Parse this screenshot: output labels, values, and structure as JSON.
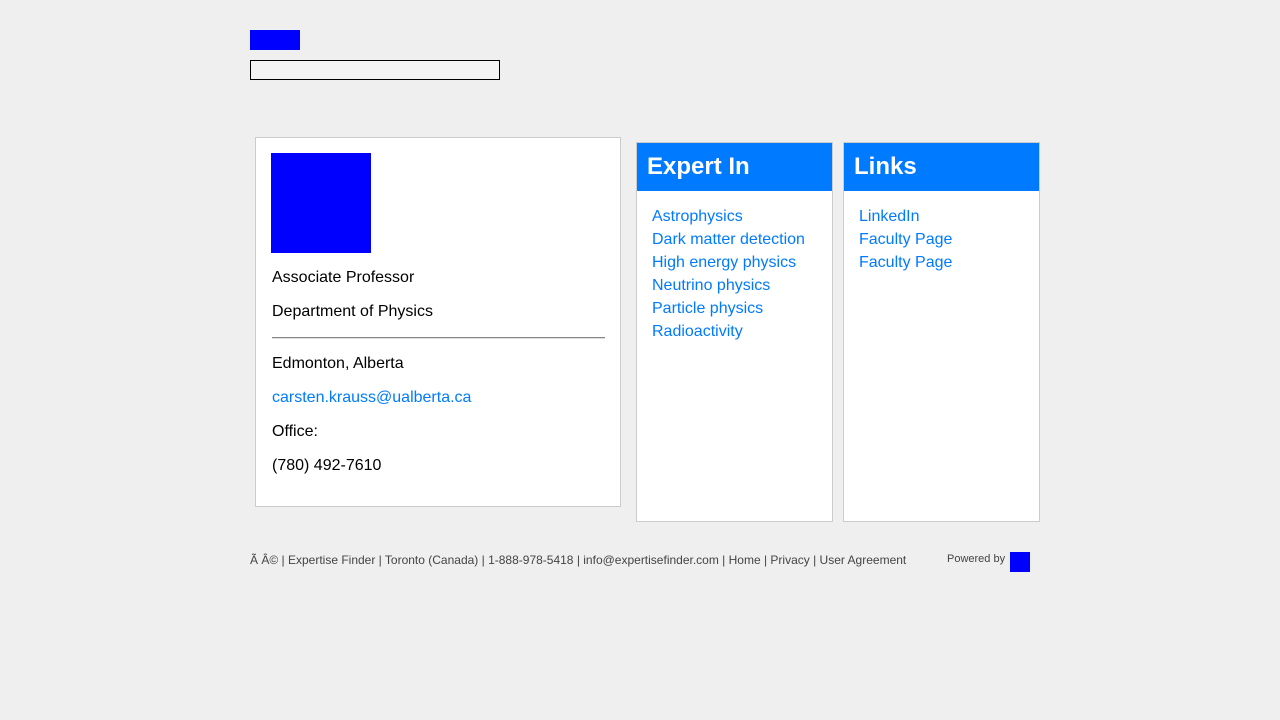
{
  "search": {
    "value": ""
  },
  "profile": {
    "title": "Associate Professor",
    "department": "Department of Physics",
    "location": "Edmonton, Alberta",
    "email": "carsten.krauss@ualberta.ca",
    "office_label": "Office:",
    "phone": "(780) 492-7610"
  },
  "expert": {
    "heading": "Expert In",
    "items": [
      "Astrophysics",
      "Dark matter detection",
      "High energy physics",
      "Neutrino physics",
      "Particle physics",
      "Radioactivity"
    ]
  },
  "links": {
    "heading": "Links",
    "items": [
      "LinkedIn",
      "Faculty Page",
      "Faculty Page"
    ]
  },
  "footer": {
    "text": "Ã   Â© | Expertise Finder | Toronto (Canada) | 1-888-978-5418 | info@expertisefinder.com | Home | Privacy | User Agreement",
    "powered_by": "Powered by"
  },
  "colors": {
    "accent": "#007bff",
    "logo_placeholder": "#0000ff",
    "background": "#efefef"
  }
}
